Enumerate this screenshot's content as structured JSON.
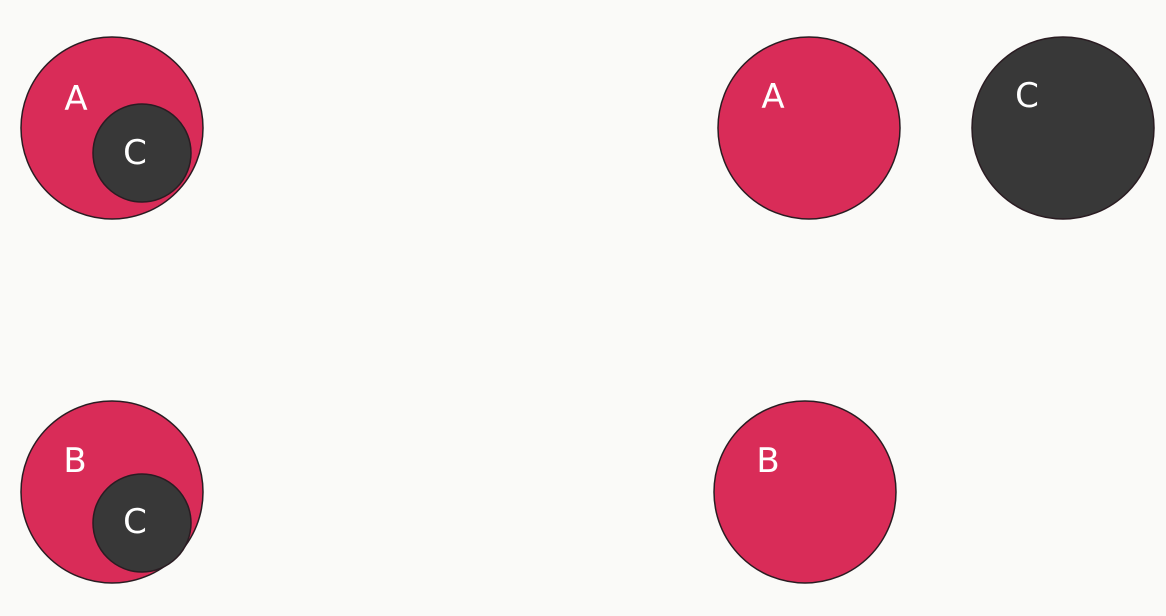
{
  "colors": {
    "background": "#fafaf8",
    "set_fill": "#d92c58",
    "subset_fill": "#383838",
    "outline": "#2a1c22",
    "label": "#ffffff"
  },
  "diagrams": {
    "a_contains_c": {
      "outer_label": "A",
      "inner_label": "C"
    },
    "b_contains_c": {
      "outer_label": "B",
      "inner_label": "C"
    },
    "a_separate": {
      "label": "A"
    },
    "c_separate": {
      "label": "C"
    },
    "b_separate": {
      "label": "B"
    }
  }
}
